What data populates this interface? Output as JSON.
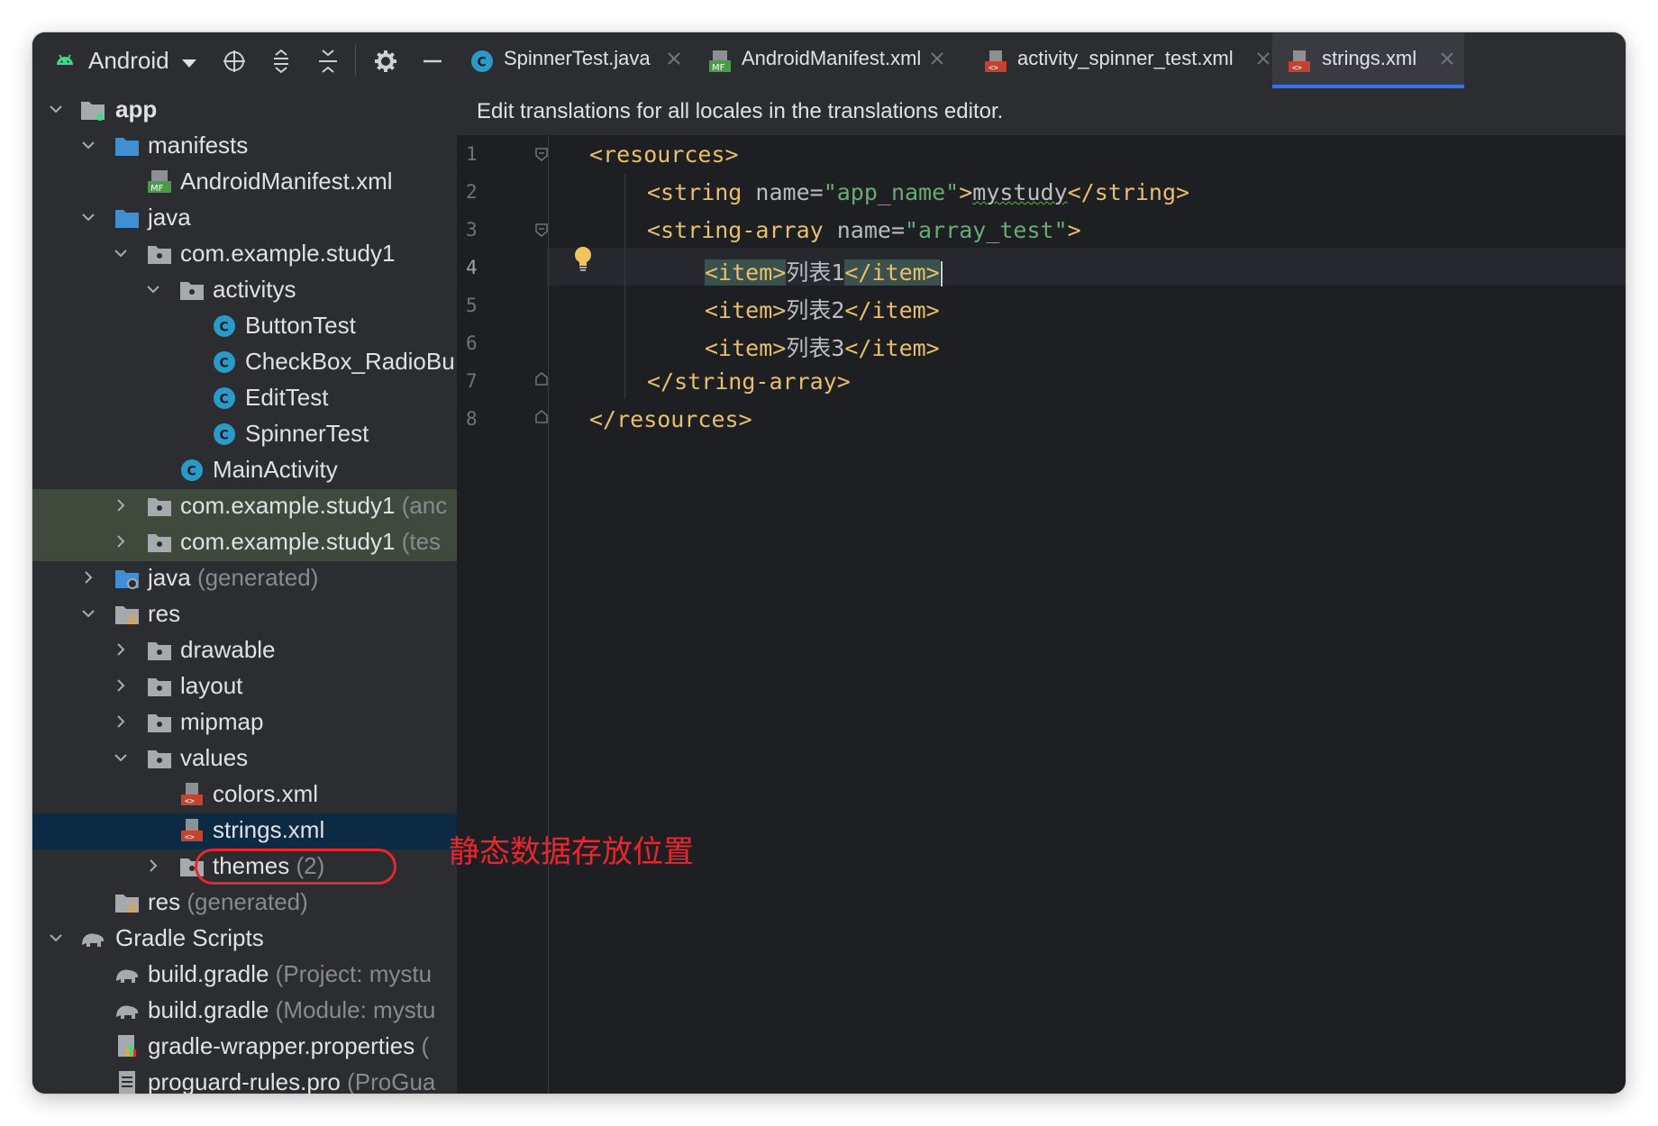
{
  "toolbar": {
    "title": "Android",
    "icons": [
      "android-icon",
      "crosshair-icon",
      "expand-all-icon",
      "collapse-all-icon",
      "gear-icon",
      "minimize-icon"
    ]
  },
  "tabs": [
    {
      "label": "SpinnerTest.java",
      "icon": "java-class-icon",
      "active": false
    },
    {
      "label": "AndroidManifest.xml",
      "icon": "manifest-icon",
      "active": false
    },
    {
      "label": "activity_spinner_test.xml",
      "icon": "layout-xml-icon",
      "active": false
    },
    {
      "label": "strings.xml",
      "icon": "values-xml-icon",
      "active": true
    }
  ],
  "banner": "Edit translations for all locales in the translations editor.",
  "tree": [
    {
      "label": "app",
      "extra": "",
      "expanded": true
    },
    {
      "label": "manifests",
      "extra": "",
      "expanded": true
    },
    {
      "label": "AndroidManifest.xml",
      "extra": ""
    },
    {
      "label": "java",
      "extra": "",
      "expanded": true
    },
    {
      "label": "com.example.study1",
      "extra": "",
      "expanded": true
    },
    {
      "label": "activitys",
      "extra": "",
      "expanded": true
    },
    {
      "label": "ButtonTest",
      "extra": ""
    },
    {
      "label": "CheckBox_RadioBu",
      "extra": ""
    },
    {
      "label": "EditTest",
      "extra": ""
    },
    {
      "label": "SpinnerTest",
      "extra": ""
    },
    {
      "label": "MainActivity",
      "extra": ""
    },
    {
      "label": "com.example.study1",
      "extra": "(anc",
      "expanded": false
    },
    {
      "label": "com.example.study1",
      "extra": "(tes",
      "expanded": false
    },
    {
      "label": "java",
      "extra": "(generated)",
      "expanded": false
    },
    {
      "label": "res",
      "extra": "",
      "expanded": true
    },
    {
      "label": "drawable",
      "extra": "",
      "expanded": false
    },
    {
      "label": "layout",
      "extra": "",
      "expanded": false
    },
    {
      "label": "mipmap",
      "extra": "",
      "expanded": false
    },
    {
      "label": "values",
      "extra": "",
      "expanded": true
    },
    {
      "label": "colors.xml",
      "extra": ""
    },
    {
      "label": "strings.xml",
      "extra": "",
      "selected": true
    },
    {
      "label": "themes",
      "extra": "(2)",
      "expanded": false
    },
    {
      "label": "res",
      "extra": "(generated)"
    },
    {
      "label": "Gradle Scripts",
      "extra": "",
      "expanded": true
    },
    {
      "label": "build.gradle",
      "extra": "(Project: mystu"
    },
    {
      "label": "build.gradle",
      "extra": "(Module: mystu"
    },
    {
      "label": "gradle-wrapper.properties",
      "extra": "("
    },
    {
      "label": "proguard-rules.pro",
      "extra": "(ProGua"
    }
  ],
  "editor": {
    "line_numbers": [
      "1",
      "2",
      "3",
      "4",
      "5",
      "6",
      "7",
      "8"
    ],
    "current_line": "4",
    "code": {
      "l1_open": "<resources>",
      "l2_open": "<string",
      "l2_attr": "name=",
      "l2_val": "\"app_name\"",
      "l2_gt": ">",
      "l2_text": "mystudy",
      "l2_close": "</string>",
      "l3_open": "<string-array",
      "l3_attr": "name=",
      "l3_val": "\"array_test\"",
      "l3_gt": ">",
      "l4_open": "<item>",
      "l4_text": "列表1",
      "l4_close": "</item>",
      "l5_open": "<item>",
      "l5_text": "列表2",
      "l5_close": "</item>",
      "l6_open": "<item>",
      "l6_text": "列表3",
      "l6_close": "</item>",
      "l7_close": "</string-array>",
      "l8_close": "</resources>"
    }
  },
  "annotation": {
    "text": "静态数据存放位置",
    "color": "#e8262d"
  },
  "colors": {
    "tag": "#e8bf6a",
    "string_value": "#6aab73",
    "selection": "#0d2a45",
    "accent": "#3574f0"
  }
}
